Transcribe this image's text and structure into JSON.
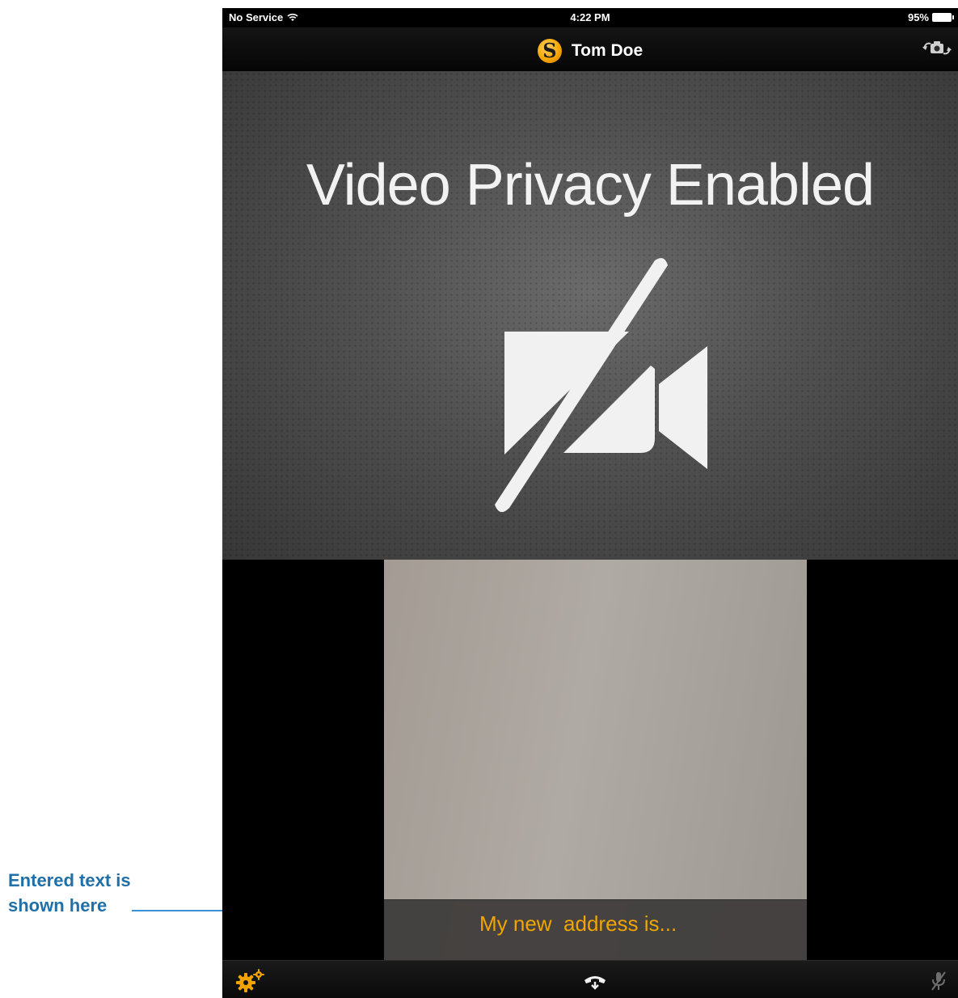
{
  "annotation": {
    "line1": "Entered text is",
    "line2": "shown here"
  },
  "status_bar": {
    "carrier": "No Service",
    "time": "4:22 PM",
    "battery": "95%"
  },
  "nav": {
    "logo_letter": "S",
    "title": "Tom Doe"
  },
  "remote": {
    "privacy_text": "Video Privacy Enabled"
  },
  "caption": {
    "text": "My new  address is..."
  },
  "icons": {
    "status_wifi": "wifi-icon",
    "battery": "battery-icon",
    "camera_switch": "camera-switch-icon",
    "privacy": "video-off-icon",
    "settings": "gears-icon",
    "hangup": "hang-up-icon",
    "mute": "microphone-mute-icon"
  },
  "colors": {
    "accent": "#f0a500",
    "annotation": "#1f6fa8",
    "arrow": "#3b8fd6"
  }
}
